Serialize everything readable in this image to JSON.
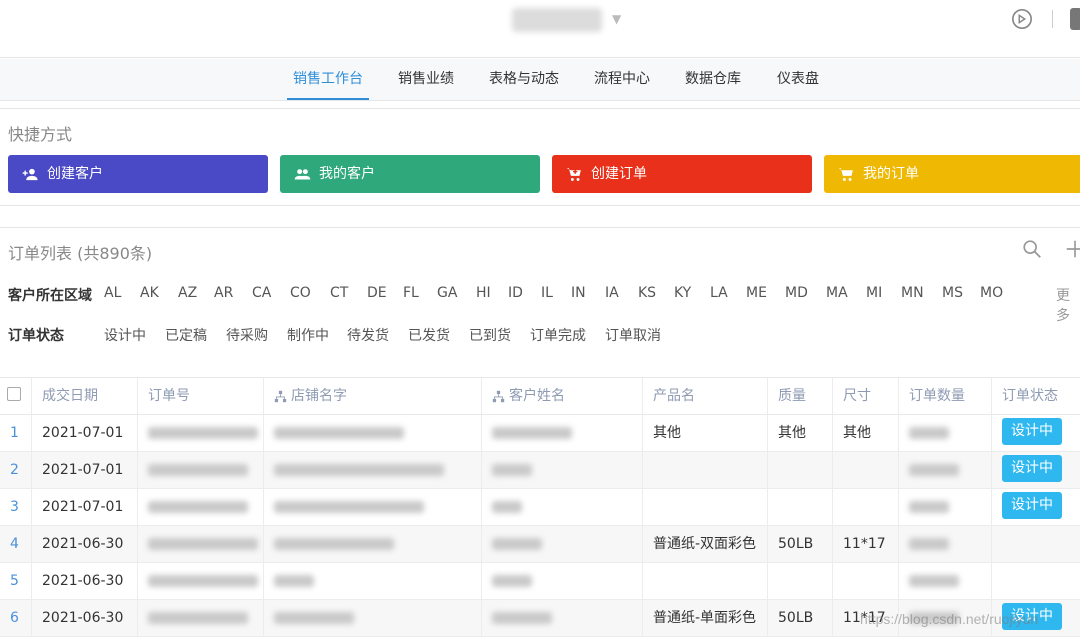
{
  "nav": {
    "tabs": [
      {
        "label": "销售工作台",
        "active": true
      },
      {
        "label": "销售业绩"
      },
      {
        "label": "表格与动态"
      },
      {
        "label": "流程中心"
      },
      {
        "label": "数据仓库"
      },
      {
        "label": "仪表盘"
      }
    ]
  },
  "shortcuts": {
    "title": "快捷方式",
    "items": [
      {
        "label": "创建客户",
        "icon": "user-plus-icon",
        "color": "#4b4ac6"
      },
      {
        "label": "我的客户",
        "icon": "users-icon",
        "color": "#2fa97b"
      },
      {
        "label": "创建订单",
        "icon": "cart-plus-icon",
        "color": "#e8301a"
      },
      {
        "label": "我的订单",
        "icon": "cart-icon",
        "color": "#efb803"
      }
    ]
  },
  "orders": {
    "title": "订单列表 (共890条)",
    "region_filter": {
      "label": "客户所在区域",
      "options": [
        "AL",
        "AK",
        "AZ",
        "AR",
        "CA",
        "CO",
        "CT",
        "DE",
        "FL",
        "GA",
        "HI",
        "ID",
        "IL",
        "IN",
        "IA",
        "KS",
        "KY",
        "LA",
        "ME",
        "MD",
        "MA",
        "MI",
        "MN",
        "MS",
        "MO"
      ],
      "more": "更多"
    },
    "status_filter": {
      "label": "订单状态",
      "options": [
        "设计中",
        "已定稿",
        "待采购",
        "制作中",
        "待发货",
        "已发货",
        "已到货",
        "订单完成",
        "订单取消"
      ]
    },
    "columns": [
      "成交日期",
      "订单号",
      "店铺名字",
      "客户姓名",
      "产品名",
      "质量",
      "尺寸",
      "订单数量",
      "订单状态"
    ],
    "rows": [
      {
        "index": "1",
        "date": "2021-07-01",
        "product": "其他",
        "quality": "其他",
        "size": "其他",
        "status": "设计中"
      },
      {
        "index": "2",
        "date": "2021-07-01",
        "product": "",
        "quality": "",
        "size": "",
        "status": "设计中"
      },
      {
        "index": "3",
        "date": "2021-07-01",
        "product": "",
        "quality": "",
        "size": "",
        "status": "设计中"
      },
      {
        "index": "4",
        "date": "2021-06-30",
        "product": "普通纸-双面彩色",
        "quality": "50LB",
        "size": "11*17",
        "status": ""
      },
      {
        "index": "5",
        "date": "2021-06-30",
        "product": "",
        "quality": "",
        "size": "",
        "status": ""
      },
      {
        "index": "6",
        "date": "2021-06-30",
        "product": "普通纸-单面彩色",
        "quality": "50LB",
        "size": "11*17",
        "status": "设计中"
      }
    ]
  },
  "watermark": "https://blog.csdn.net/ruojiyun"
}
